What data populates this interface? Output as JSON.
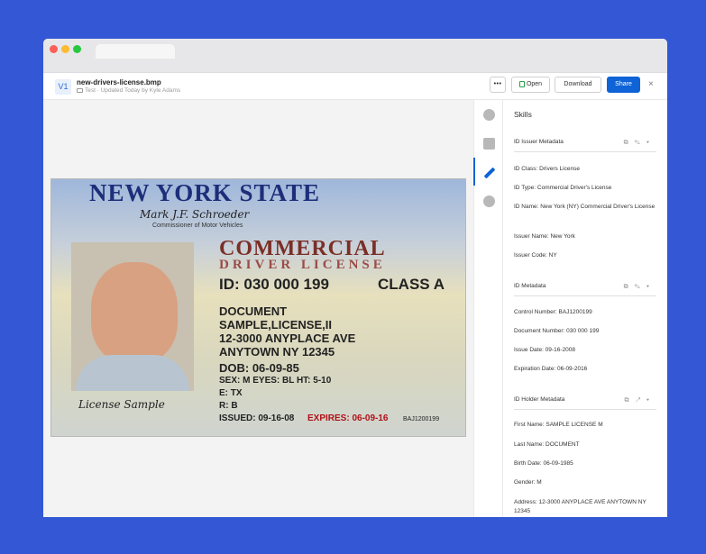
{
  "file": {
    "version": "V1",
    "name": "new-drivers-license.bmp",
    "folder": "Test",
    "updated": "Updated Today by Kyle Adams"
  },
  "toolbar": {
    "more": "•••",
    "open": "Open",
    "download": "Download",
    "share": "Share",
    "close": "×"
  },
  "license": {
    "state": "NEW YORK STATE",
    "commissioner": "Commissioner of Motor Vehicles",
    "type_line1": "COMMERCIAL",
    "type_line2": "DRIVER LICENSE",
    "id": "ID: 030 000 199",
    "class": "CLASS A",
    "line1": "DOCUMENT",
    "line2": "SAMPLE,LICENSE,II",
    "line3": "12-3000 ANYPLACE AVE",
    "line4": "ANYTOWN NY 12345",
    "dob": "DOB: 06-09-85",
    "physical": "SEX: M   EYES: BL   HT: 5-10",
    "e": "E: TX",
    "r": "R: B",
    "issued": "ISSUED: 09-16-08",
    "expires": "EXPIRES: 06-09-16",
    "serial": "BAJ1200199"
  },
  "skills": {
    "title": "Skills",
    "sections": [
      {
        "name": "ID Issuer Metadata",
        "fields": [
          "ID Class: Drivers License",
          "ID Type: Commercial Driver's License",
          "ID Name: New York (NY) Commercial Driver's License",
          "Issuer Name: New York",
          "Issuer Code: NY"
        ]
      },
      {
        "name": "ID Metadata",
        "fields": [
          "Control Number: BAJ1200199",
          "Document Number: 030 000 199",
          "Issue Date: 09-16-2008",
          "Expiration Date: 06-09-2016"
        ]
      },
      {
        "name": "ID Holder Metadata",
        "fields": [
          "First Name: SAMPLE LICENSE M",
          "Last Name: DOCUMENT",
          "Birth Date: 06-09-1985",
          "Gender: M",
          "Address: 12-3000 ANYPLACE AVE ANYTOWN NY 12345"
        ]
      }
    ]
  }
}
